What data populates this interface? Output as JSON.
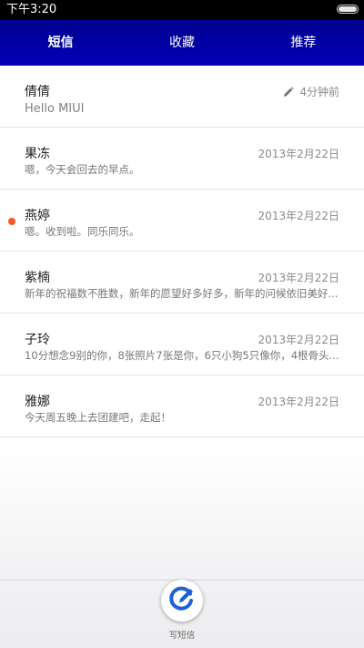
{
  "status_bar": {
    "time": "下午3:20"
  },
  "tabs": [
    {
      "label": "短信",
      "active": true
    },
    {
      "label": "收藏",
      "active": false
    },
    {
      "label": "推荐",
      "active": false
    }
  ],
  "conversations": [
    {
      "name": "倩倩",
      "preview": "Hello MIUI",
      "time": "4分钟前",
      "draft": true,
      "unread": false
    },
    {
      "name": "果冻",
      "preview": "嗯，今天会回去的早点。",
      "time": "2013年2月22日",
      "draft": false,
      "unread": false
    },
    {
      "name": "燕婷",
      "preview": "嗯。收到啦。同乐同乐。",
      "time": "2013年2月22日",
      "draft": false,
      "unread": true
    },
    {
      "name": "紫楠",
      "preview": "新年的祝福数不胜数，新年的愿望好多好多，新年的问候依旧美好...",
      "time": "2013年2月22日",
      "draft": false,
      "unread": false
    },
    {
      "name": "子玲",
      "preview": "10分想念9别的你，8张照片7张是你，6只小狗5只像你，4根骨头...",
      "time": "2013年2月22日",
      "draft": false,
      "unread": false
    },
    {
      "name": "雅娜",
      "preview": "今天周五晚上去团建吧，走起！",
      "time": "2013年2月22日",
      "draft": false,
      "unread": false
    }
  ],
  "compose": {
    "label": "写短信",
    "icon": "compose-icon"
  },
  "colors": {
    "tab_bar": "#0000a8",
    "unread_dot": "#f5581f",
    "compose_accent": "#1f5fd9"
  }
}
